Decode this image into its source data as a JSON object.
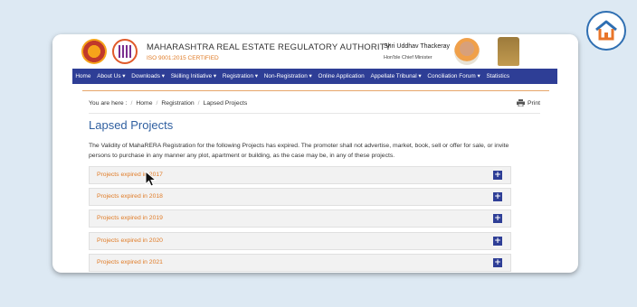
{
  "header": {
    "org_title": "MAHARASHTRA REAL ESTATE REGULATORY AUTHORITY",
    "iso": "ISO 9001:2015 CERTIFIED",
    "cm_name": "Shri Uddhav Thackeray",
    "cm_role": "Hon'ble Chief Minister"
  },
  "nav": [
    "Home",
    "About Us ▾",
    "Downloads ▾",
    "Skilling Initiative ▾",
    "Registration ▾",
    "Non-Registration ▾",
    "Online Application",
    "Appellate Tribunal ▾",
    "Conciliation Forum ▾",
    "Statistics"
  ],
  "breadcrumb": {
    "prefix": "You are here :",
    "home": "Home",
    "registration": "Registration",
    "current": "Lapsed Projects"
  },
  "print_label": "Print",
  "page_title": "Lapsed Projects",
  "notice": "The Validity of MahaRERA Registration for the following Projects has expired. The promoter shall not advertise, market, book, sell or offer for sale, or invite persons to purchase in any manner any plot, apartment or building, as the case may be, in any of these projects.",
  "accordion": [
    "Projects expired in 2017",
    "Projects expired in 2018",
    "Projects expired in 2019",
    "Projects expired in 2020",
    "Projects expired in 2021"
  ],
  "accordion_toggle": "+",
  "colors": {
    "nav": "#2e3e96",
    "accent": "#e07b26",
    "title": "#2f5fa0"
  },
  "icons": [
    "home-badge-icon",
    "print-icon",
    "plus-icon",
    "cursor-icon"
  ]
}
